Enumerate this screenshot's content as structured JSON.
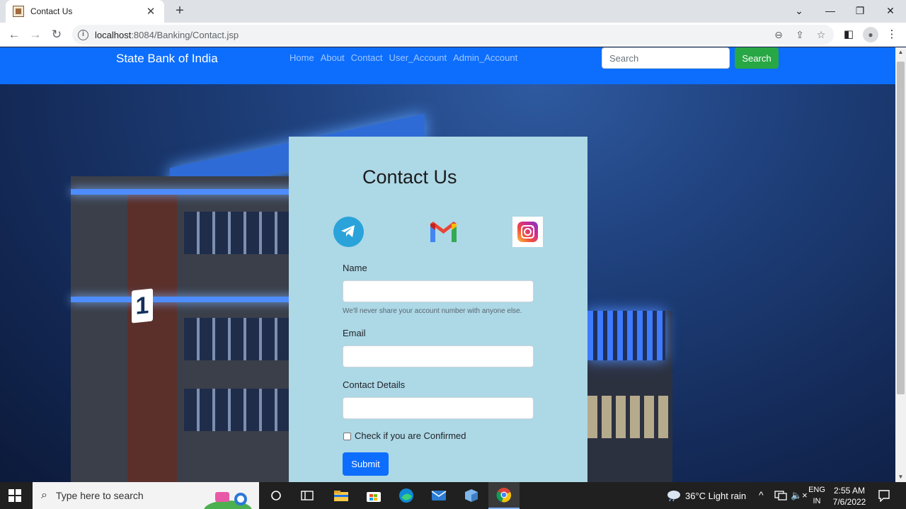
{
  "browser": {
    "tab_title": "Contact Us",
    "url_host": "localhost",
    "url_path": ":8084/Banking/Contact.jsp"
  },
  "navbar": {
    "brand": "State Bank of India",
    "links": [
      "Home",
      "About",
      "Contact",
      "User_Account",
      "Admin_Account"
    ],
    "search_placeholder": "Search",
    "search_button": "Search"
  },
  "form": {
    "title": "Contact Us",
    "social": [
      "telegram-icon",
      "gmail-icon",
      "instagram-icon"
    ],
    "name_label": "Name",
    "name_help": "We'll never share your account number with anyone else.",
    "email_label": "Email",
    "contact_label": "Contact Details",
    "checkbox_label": "Check if you are Confirmed",
    "submit_label": "Submit"
  },
  "taskbar": {
    "search_placeholder": "Type here to search",
    "weather": "36°C  Light rain",
    "lang_top": "ENG",
    "lang_bottom": "IN",
    "time": "2:55 AM",
    "date": "7/6/2022"
  },
  "colors": {
    "navbar": "#0d6efd",
    "card": "#add8e6",
    "search_button": "#28a745"
  }
}
